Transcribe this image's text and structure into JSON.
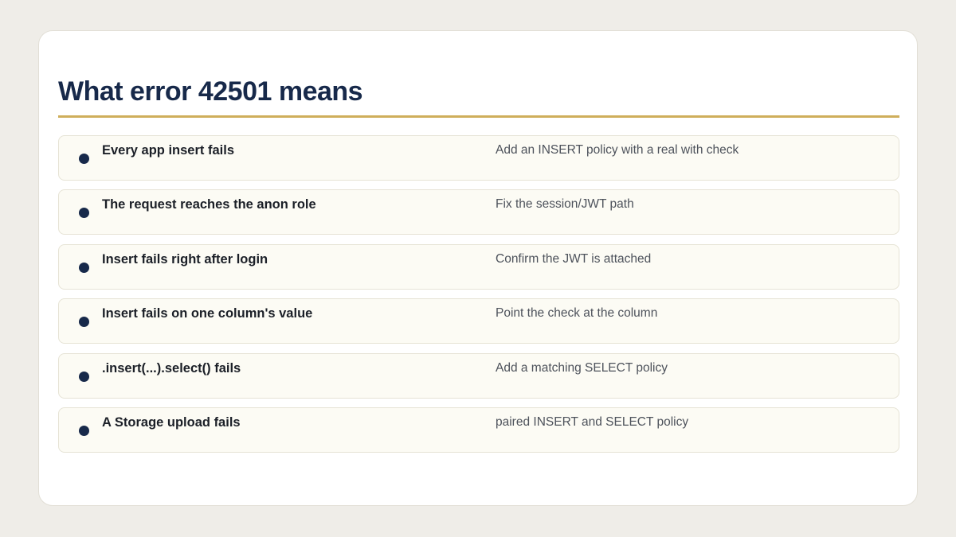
{
  "slide": {
    "title": "What error 42501 means",
    "accent_color": "#cfae5b",
    "title_color": "#17294a",
    "rows": [
      {
        "symptom": "Every app insert fails",
        "action": "Add an INSERT policy with a real with check"
      },
      {
        "symptom": "The request reaches the anon role",
        "action": "Fix the session/JWT path"
      },
      {
        "symptom": "Insert fails right after login",
        "action": "Confirm the JWT is attached"
      },
      {
        "symptom": "Insert fails on one column's value",
        "action": "Point the check at the column"
      },
      {
        "symptom": ".insert(...).select() fails",
        "action": "Add a matching SELECT policy"
      },
      {
        "symptom": "A Storage upload fails",
        "action": "paired INSERT and SELECT policy"
      }
    ]
  }
}
